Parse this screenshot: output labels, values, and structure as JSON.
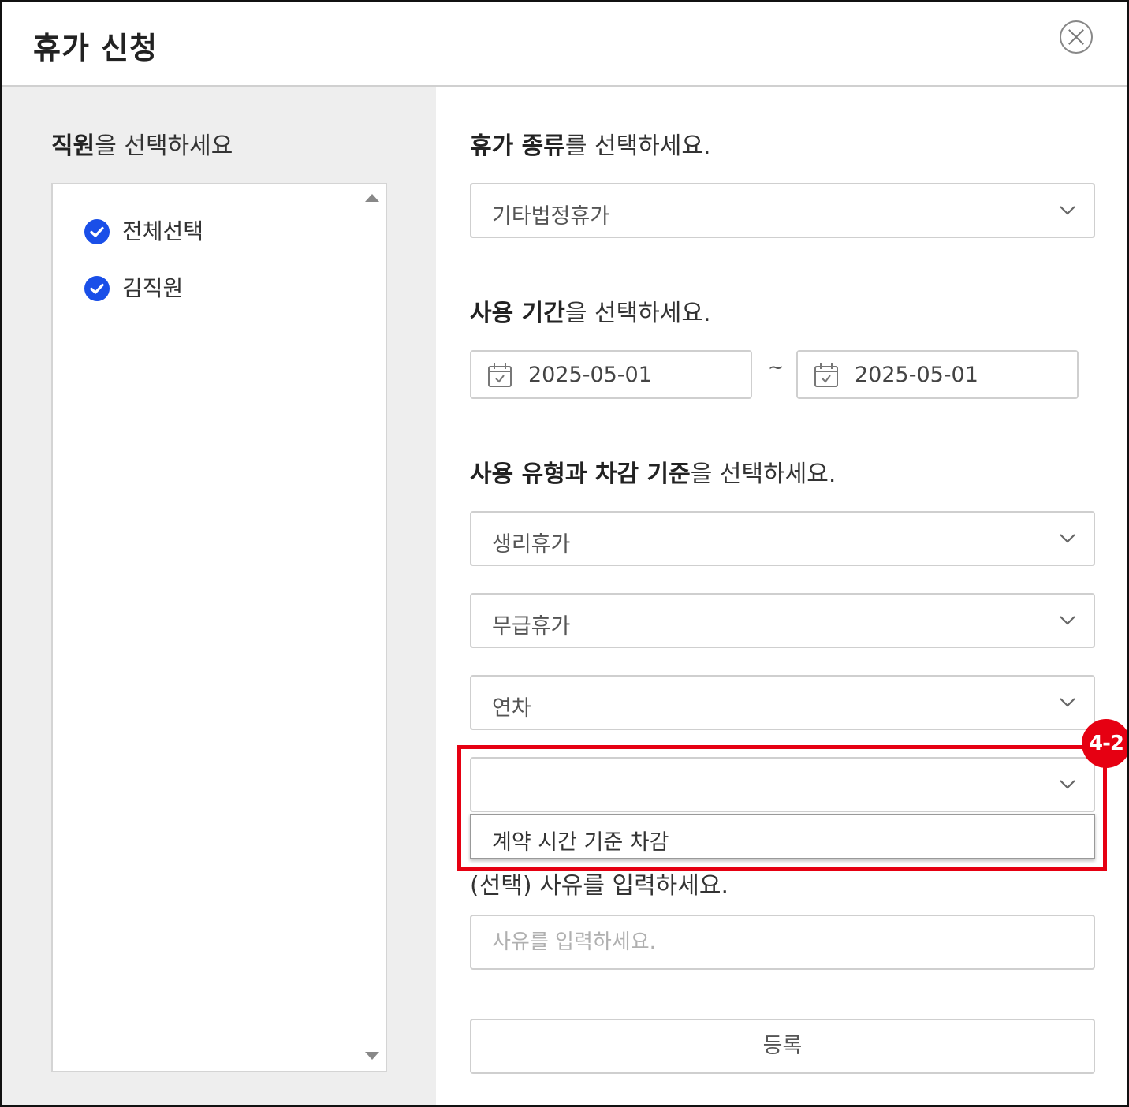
{
  "dialog": {
    "title": "휴가 신청"
  },
  "employees": {
    "heading_bold": "직원",
    "heading_rest": "을 선택하세요",
    "items": [
      {
        "label": "전체선택",
        "checked": true
      },
      {
        "label": "김직원",
        "checked": true
      }
    ]
  },
  "leave_type": {
    "heading_bold": "휴가 종류",
    "heading_rest": "를 선택하세요.",
    "value": "기타법정휴가"
  },
  "period": {
    "heading_bold": "사용 기간",
    "heading_rest": "을 선택하세요.",
    "start": "2025-05-01",
    "separator": "~",
    "end": "2025-05-01"
  },
  "usage": {
    "heading_bold": "사용 유형과 차감 기준",
    "heading_rest": "을 선택하세요.",
    "select1": "생리휴가",
    "select2": "무급휴가",
    "select3": "연차",
    "select4": "",
    "dropdown_option": "계약 시간 기준 차감"
  },
  "reason": {
    "heading": "(선택) 사유를 입력하세요.",
    "placeholder": "사유를 입력하세요."
  },
  "submit_label": "등록",
  "annotation": {
    "step_label": "4-2",
    "color": "#e60012"
  },
  "colors": {
    "check": "#1a4fe8",
    "left_panel_bg": "#eeeeee"
  }
}
